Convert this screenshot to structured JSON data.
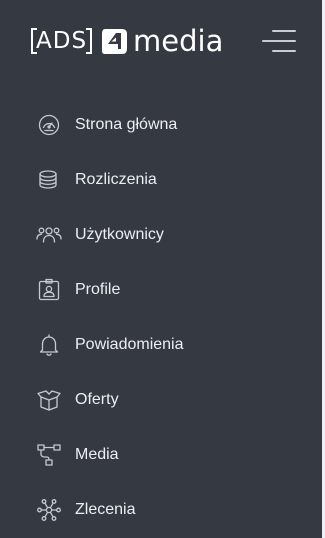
{
  "brand": {
    "ads": "ADS",
    "media": "media"
  },
  "nav": {
    "items": [
      {
        "label": "Strona główna",
        "icon": "dashboard-gauge-icon"
      },
      {
        "label": "Rozliczenia",
        "icon": "coins-stack-icon"
      },
      {
        "label": "Użytkownicy",
        "icon": "users-group-icon"
      },
      {
        "label": "Profile",
        "icon": "id-badge-icon"
      },
      {
        "label": "Powiadomienia",
        "icon": "bell-icon"
      },
      {
        "label": "Oferty",
        "icon": "open-box-icon"
      },
      {
        "label": "Media",
        "icon": "flowchart-icon"
      },
      {
        "label": "Zlecenia",
        "icon": "network-nodes-icon"
      }
    ]
  },
  "colors": {
    "sidebar_bg": "#353a42",
    "text": "#eceef1",
    "icon": "#c6c9ce",
    "logo": "#ffffff"
  }
}
